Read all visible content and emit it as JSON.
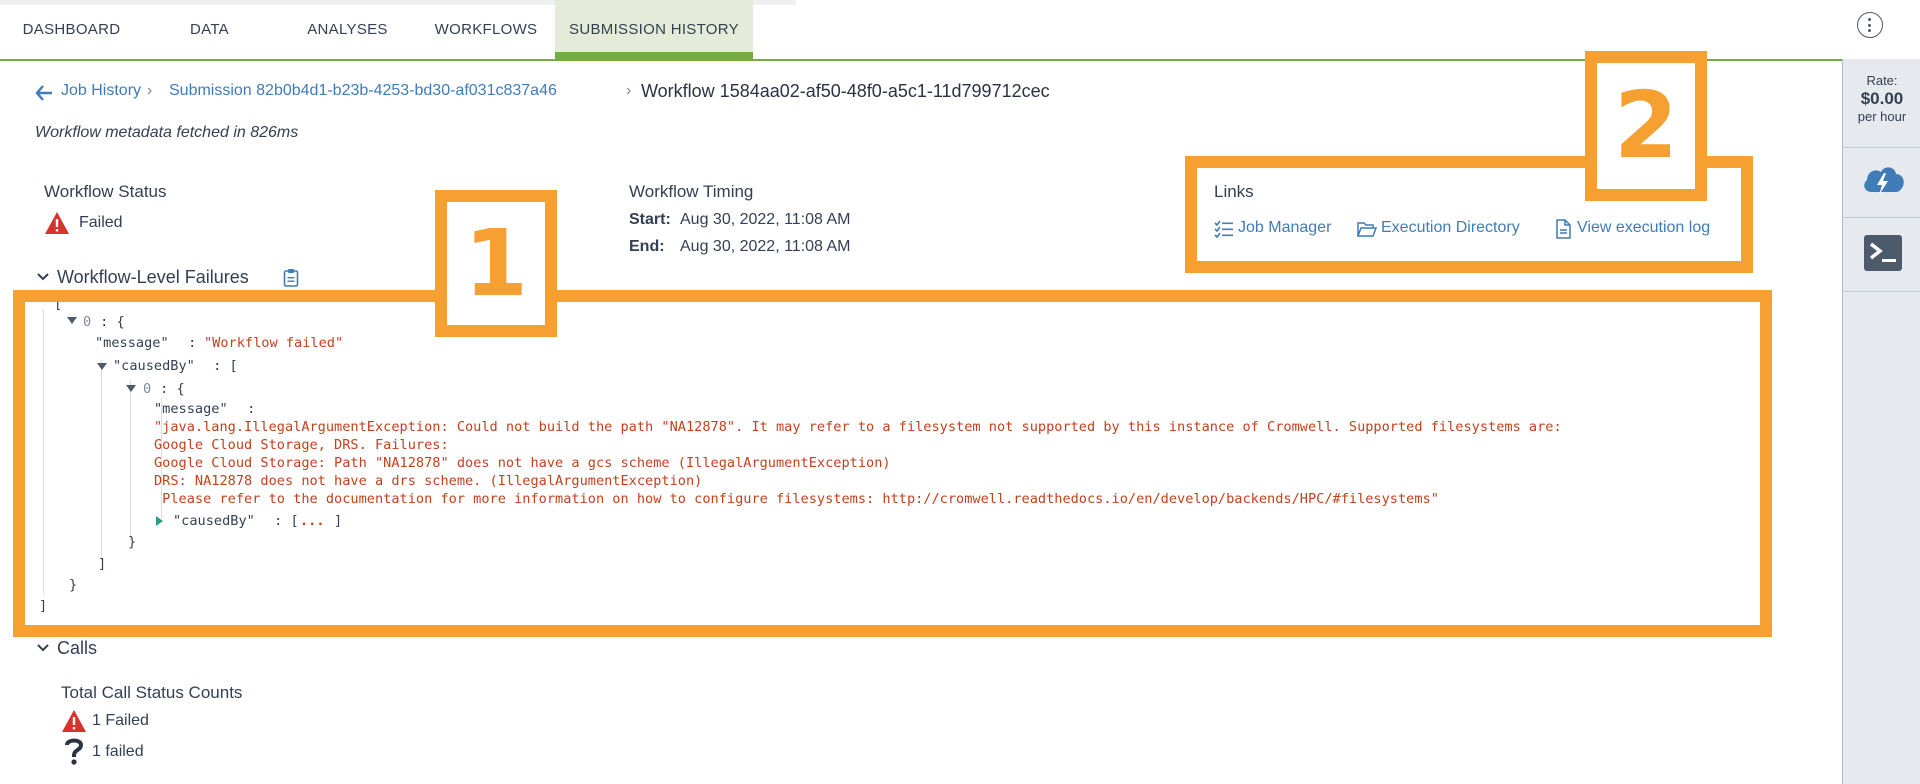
{
  "nav": {
    "tabs": [
      {
        "label": "DASHBOARD"
      },
      {
        "label": "DATA"
      },
      {
        "label": "ANALYSES"
      },
      {
        "label": "WORKFLOWS"
      },
      {
        "label": "SUBMISSION HISTORY"
      }
    ],
    "active_tab": "SUBMISSION HISTORY",
    "menu_icon": "kebab-menu-icon"
  },
  "side_panel": {
    "rate_label": "Rate:",
    "rate_value": "$0.00",
    "rate_unit": "per hour",
    "cloud_icon": "cloud-lightning-icon",
    "terminal_icon": "terminal-icon"
  },
  "breadcrumb": {
    "back_icon": "arrow-left-icon",
    "job_history": "Job History",
    "submission": "Submission 82b0b4d1-b23b-4253-bd30-af031c837a46",
    "separator": "›",
    "workflow": "Workflow 1584aa02-af50-48f0-a5c1-11d799712cec"
  },
  "fetch_note": "Workflow metadata fetched in 826ms",
  "status": {
    "heading": "Workflow Status",
    "value": "Failed",
    "icon": "warning-icon"
  },
  "timing": {
    "heading": "Workflow Timing",
    "start_label": "Start:",
    "start_value": "Aug 30, 2022, 11:08 AM",
    "end_label": "End:",
    "end_value": "Aug 30, 2022, 11:08 AM"
  },
  "links": {
    "heading": "Links",
    "job_manager": "Job Manager",
    "execution_directory": "Execution Directory",
    "execution_log": "View execution log"
  },
  "failures": {
    "heading": "Workflow-Level Failures",
    "copy_icon": "clipboard-icon",
    "json": {
      "bracket_open": "[",
      "idx0": "0",
      "colon_brace": " : {",
      "message_key": "\"message\"",
      "message_colon": " : ",
      "message_value": "\"Workflow failed\"",
      "caused_by_key": "\"causedBy\"",
      "colon_bracket": " : [",
      "inner_idx": "0",
      "inner_message_key": "\"message\"",
      "inner_message_colon": " :",
      "inner_message_lines": [
        "\"java.lang.IllegalArgumentException: Could not build the path \"NA12878\". It may refer to a filesystem not supported by this instance of Cromwell. Supported filesystems are:",
        "Google Cloud Storage, DRS. Failures:",
        "Google Cloud Storage: Path \"NA12878\" does not have a gcs scheme (IllegalArgumentException)",
        "DRS: NA12878 does not have a drs scheme. (IllegalArgumentException)",
        " Please refer to the documentation for more information on how to configure filesystems: http://cromwell.readthedocs.io/en/develop/backends/HPC/#filesystems\""
      ],
      "collapsed_key": "\"causedBy\"",
      "collapsed_colon": " : [",
      "collapsed_ellipsis": "...",
      "collapsed_close": "]",
      "brace_close": "}",
      "bracket_close": "]"
    }
  },
  "calls": {
    "heading": "Calls",
    "total_heading": "Total Call Status Counts",
    "failed_label": "1 Failed",
    "unknown_label": "1 failed"
  },
  "annotations": {
    "box1_label": "1",
    "box2_label": "2",
    "color": "#f5a030"
  }
}
